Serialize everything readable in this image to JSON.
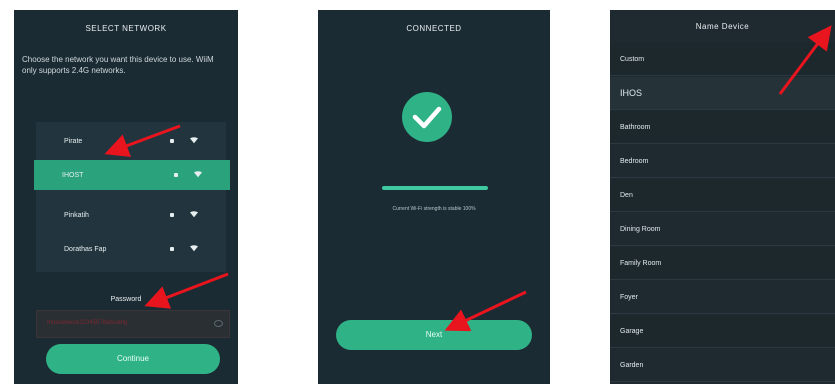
{
  "screen1": {
    "title": "SELECT NETWORK",
    "description_before": "Choose the network you want this device to use. ",
    "brand": "WiiM",
    "description_after": " only supports 2.4G networks.",
    "networks": [
      {
        "name": "Pirate",
        "selected": false
      },
      {
        "name": "IHOST",
        "selected": true
      },
      {
        "name": "Pinkatih",
        "selected": false
      },
      {
        "name": "Dorathas Fap",
        "selected": false
      }
    ],
    "password_label": "Password",
    "password_value": "Ihosnetwork12345678abcdefg",
    "continue_label": "Continue"
  },
  "screen2": {
    "title": "CONNECTED",
    "progress": 1.0,
    "hint": "Current Wi-Fi strength is stable 100%",
    "next_label": "Next"
  },
  "screen3": {
    "title": "Name Device",
    "rooms": [
      "Custom",
      "IHOS",
      "Bathroom",
      "Bedroom",
      "Den",
      "Dining Room",
      "Family Room",
      "Foyer",
      "Garage",
      "Garden"
    ]
  },
  "colors": {
    "accent": "#2fb286",
    "screen_bg": "#1b2b33",
    "arrow": "#e8141e"
  }
}
